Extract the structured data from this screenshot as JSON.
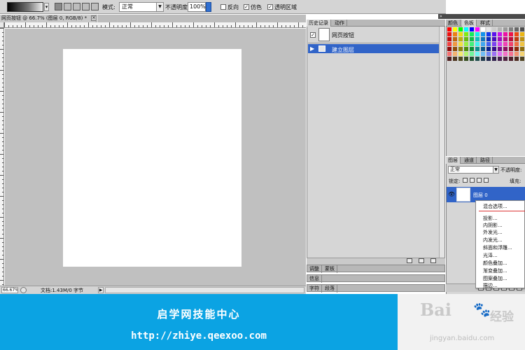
{
  "options_bar": {
    "mode_label": "模式:",
    "mode_value": "正常",
    "opacity_label": "不透明度:",
    "opacity_value": "100%",
    "reverse_label": "反向",
    "dither_label": "仿色",
    "transparency_label": "透明区域"
  },
  "document": {
    "tab_title": "网页按钮 @ 66.7% (图层 0, RGB/8) *",
    "zoom": "66.67%",
    "info": "文档:1.43M/0 字节"
  },
  "history_panel": {
    "tabs": [
      "历史记录",
      "动作"
    ],
    "snapshot_label": "网页按钮",
    "state_label": "建立图层"
  },
  "collapsed_panels": [
    [
      "调整",
      "蒙板"
    ],
    [
      "信息"
    ],
    [
      "字符",
      "段落"
    ]
  ],
  "swatches_panel": {
    "tabs": [
      "颜色",
      "色板",
      "样式"
    ]
  },
  "layers_panel": {
    "tabs": [
      "图层",
      "通道",
      "路径"
    ],
    "blend_mode": "正常",
    "opacity_label": "不透明度:",
    "lock_label": "锁定:",
    "fill_label": "填充:",
    "layer_name": "图层 0"
  },
  "context_menu": {
    "items": [
      "混合选项...",
      "投影...",
      "内阴影...",
      "外发光...",
      "内发光...",
      "斜面和浮雕...",
      "光泽...",
      "颜色叠加...",
      "渐变叠加...",
      "图案叠加...",
      "描边..."
    ]
  },
  "banner": {
    "title": "启学网技能中心",
    "url": "http://zhiye.qeexoo.com"
  },
  "watermark": {
    "logo": "Bai",
    "logo2": "经验",
    "url": "jingyan.baidu.com"
  },
  "colors": {
    "selection_blue": "#3164c8",
    "banner_blue": "#0ba3e3",
    "canvas_gray": "#c0c0c0"
  }
}
